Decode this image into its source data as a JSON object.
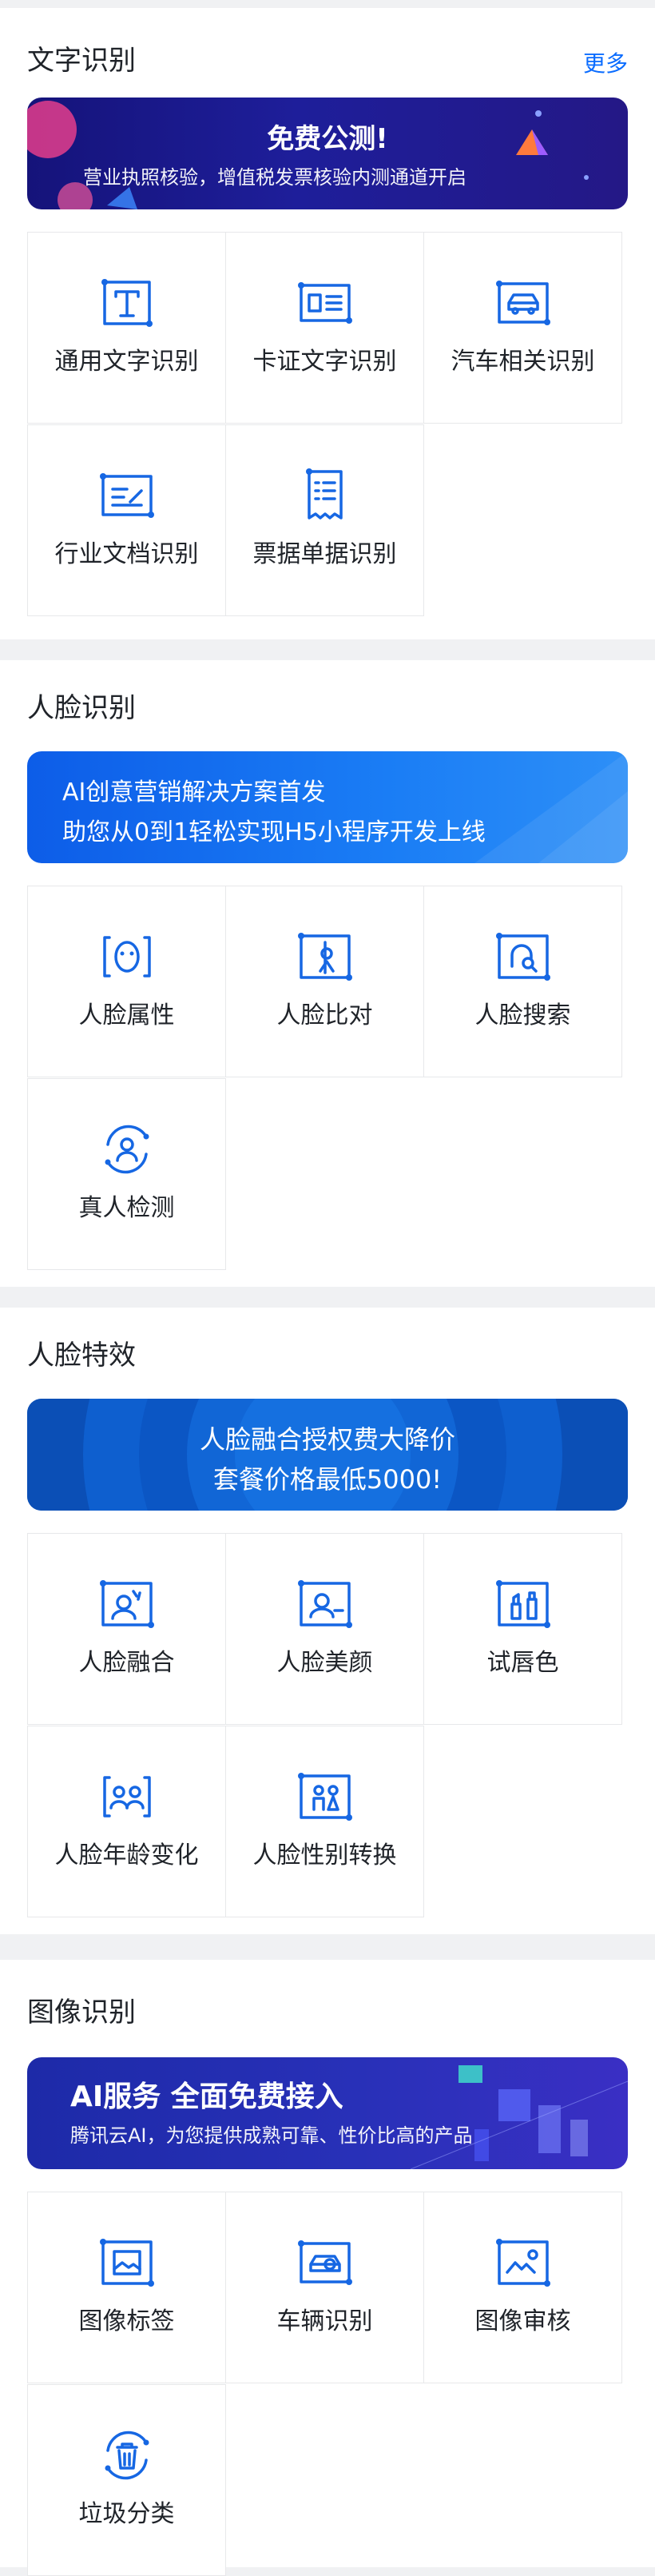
{
  "sections": [
    {
      "title": "文字识别",
      "more": "更多",
      "banner": {
        "title": "免费公测!",
        "subtitle": "营业执照核验，增值税发票核验内测通道开启"
      },
      "items": [
        {
          "label": "通用文字识别",
          "icon": "text-recognition-icon"
        },
        {
          "label": "卡证文字识别",
          "icon": "id-card-icon"
        },
        {
          "label": "汽车相关识别",
          "icon": "car-icon"
        },
        {
          "label": "行业文档识别",
          "icon": "document-icon"
        },
        {
          "label": "票据单据识别",
          "icon": "receipt-icon"
        }
      ]
    },
    {
      "title": "人脸识别",
      "banner": {
        "line1": "AI创意营销解决方案首发",
        "line2": "助您从0到1轻松实现H5小程序开发上线"
      },
      "items": [
        {
          "label": "人脸属性",
          "icon": "face-attribute-icon"
        },
        {
          "label": "人脸比对",
          "icon": "face-compare-icon"
        },
        {
          "label": "人脸搜索",
          "icon": "face-search-icon"
        },
        {
          "label": "真人检测",
          "icon": "liveness-icon"
        }
      ]
    },
    {
      "title": "人脸特效",
      "banner": {
        "line1": "人脸融合授权费大降价",
        "line2": "套餐价格最低5000!"
      },
      "items": [
        {
          "label": "人脸融合",
          "icon": "face-fusion-icon"
        },
        {
          "label": "人脸美颜",
          "icon": "face-beauty-icon"
        },
        {
          "label": "试唇色",
          "icon": "lipstick-icon"
        },
        {
          "label": "人脸年龄变化",
          "icon": "face-age-icon"
        },
        {
          "label": "人脸性别转换",
          "icon": "gender-swap-icon"
        }
      ]
    },
    {
      "title": "图像识别",
      "banner": {
        "title": "AI服务 全面免费接入",
        "subtitle": "腾讯云AI，为您提供成熟可靠、性价比高的产品"
      },
      "items": [
        {
          "label": "图像标签",
          "icon": "image-tag-icon"
        },
        {
          "label": "车辆识别",
          "icon": "vehicle-icon"
        },
        {
          "label": "图像审核",
          "icon": "image-review-icon"
        },
        {
          "label": "垃圾分类",
          "icon": "trash-icon"
        }
      ]
    }
  ],
  "colors": {
    "accent": "#0a6cff",
    "icon": "#1667e3",
    "page_bg": "#f0f1f3"
  }
}
